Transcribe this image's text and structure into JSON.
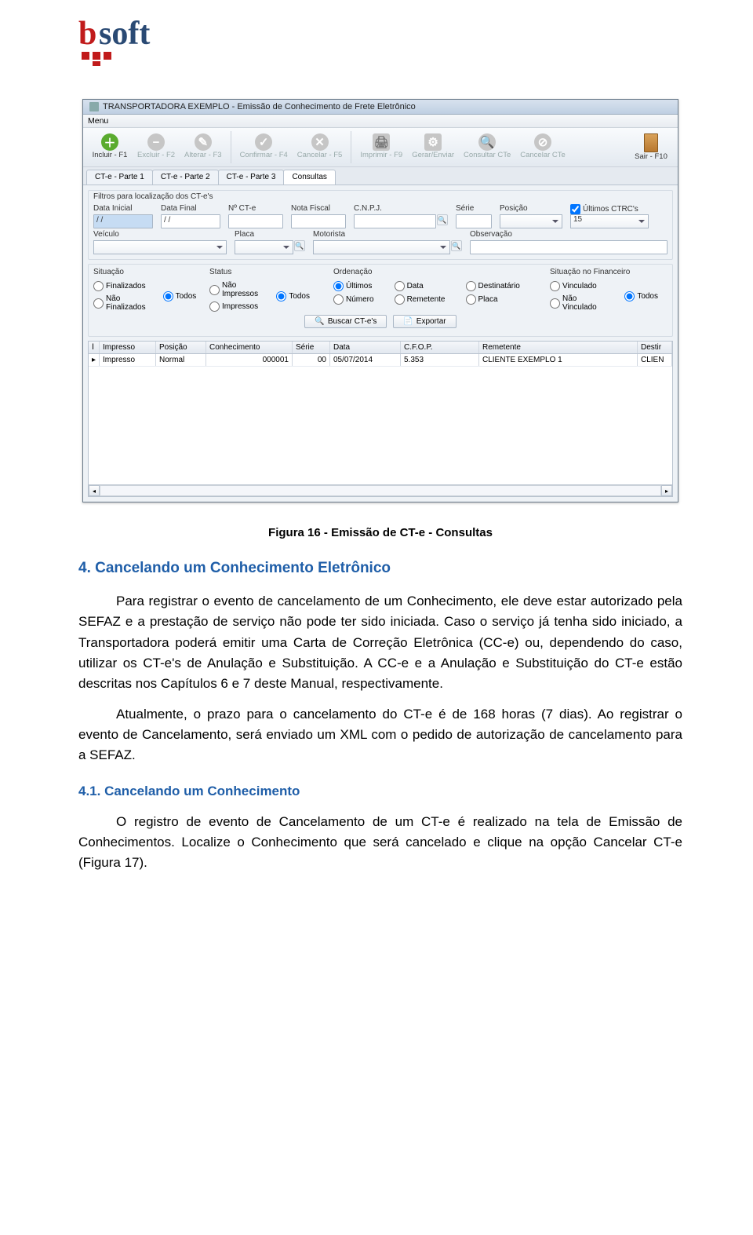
{
  "logo_text": "soft",
  "caption": "Figura 16 - Emissão de CT-e - Consultas",
  "section4": {
    "title": "4. Cancelando um Conhecimento Eletrônico",
    "p1": "Para registrar o evento de cancelamento de um Conhecimento, ele deve estar autorizado pela SEFAZ e a prestação de serviço não pode ter sido iniciada. Caso o serviço já tenha sido iniciado, a Transportadora poderá emitir uma Carta de Correção Eletrônica (CC-e) ou, dependendo do caso, utilizar os CT-e's de Anulação e Substituição. A CC-e e a Anulação e Substituição do CT-e estão descritas nos Capítulos 6 e 7 deste Manual, respectivamente.",
    "p2": "Atualmente, o prazo para o cancelamento do CT-e é de 168 horas (7 dias). Ao registrar o evento de Cancelamento, será enviado um XML com o pedido de autorização de cancelamento para a SEFAZ."
  },
  "section41": {
    "title": "4.1. Cancelando um Conhecimento",
    "p1": "O registro de evento de Cancelamento de um CT-e é realizado na tela de Emissão de Conhecimentos. Localize o Conhecimento que será cancelado e clique na opção Cancelar CT-e (Figura 17)."
  },
  "win": {
    "title": "TRANSPORTADORA EXEMPLO - Emissão de Conhecimento de Frete Eletrônico",
    "menu": "Menu",
    "toolbar": {
      "incluir": "Incluir - F1",
      "excluir": "Excluir - F2",
      "alterar": "Alterar - F3",
      "confirmar": "Confirmar - F4",
      "cancelar": "Cancelar - F5",
      "imprimir": "Imprimir - F9",
      "gerar": "Gerar/Enviar",
      "consultar": "Consultar CTe",
      "cancelarcte": "Cancelar CTe",
      "sair": "Sair - F10"
    },
    "tabs": [
      "CT-e - Parte 1",
      "CT-e - Parte 2",
      "CT-e - Parte 3",
      "Consultas"
    ],
    "filters_title": "Filtros para localização dos CT-e's",
    "fields": {
      "data_inicial": "Data Inicial",
      "data_inicial_v": "/ /",
      "data_final": "Data Final",
      "data_final_v": "/ /",
      "ncte": "Nº CT-e",
      "nota": "Nota Fiscal",
      "cnpj": "C.N.P.J.",
      "serie": "Série",
      "posicao": "Posição",
      "ultimos": "Últimos CTRC's",
      "ultimos_v": "15",
      "veiculo": "Veículo",
      "placa": "Placa",
      "motorista": "Motorista",
      "obs": "Observação"
    },
    "rgroups": {
      "situacao": {
        "label": "Situação",
        "opts": [
          "Finalizados",
          "Não Finalizados",
          "Todos"
        ],
        "sel": "Todos"
      },
      "status": {
        "label": "Status",
        "opts": [
          "Não Impressos",
          "Impressos",
          "Todos"
        ],
        "sel": "Todos"
      },
      "orden": {
        "label": "Ordenação",
        "opts": [
          "Últimos",
          "Número",
          "Data",
          "Remetente",
          "Destinatário",
          "Placa"
        ],
        "sel": "Últimos"
      },
      "sitfin": {
        "label": "Situação no Financeiro",
        "opts": [
          "Vinculado",
          "Não Vinculado",
          "Todos"
        ],
        "sel": "Todos"
      }
    },
    "buttons": {
      "buscar": "Buscar CT-e's",
      "exportar": "Exportar"
    },
    "table": {
      "headers": [
        "Impresso",
        "Posição",
        "Conhecimento",
        "Série",
        "Data",
        "C.F.O.P.",
        "Remetente",
        "Destir"
      ],
      "row": {
        "impresso": "Impresso",
        "posicao": "Normal",
        "conhecimento": "000001",
        "serie": "00",
        "data": "05/07/2014",
        "cfop": "5.353",
        "remetente": "CLIENTE EXEMPLO 1",
        "destir": "CLIEN"
      }
    }
  }
}
